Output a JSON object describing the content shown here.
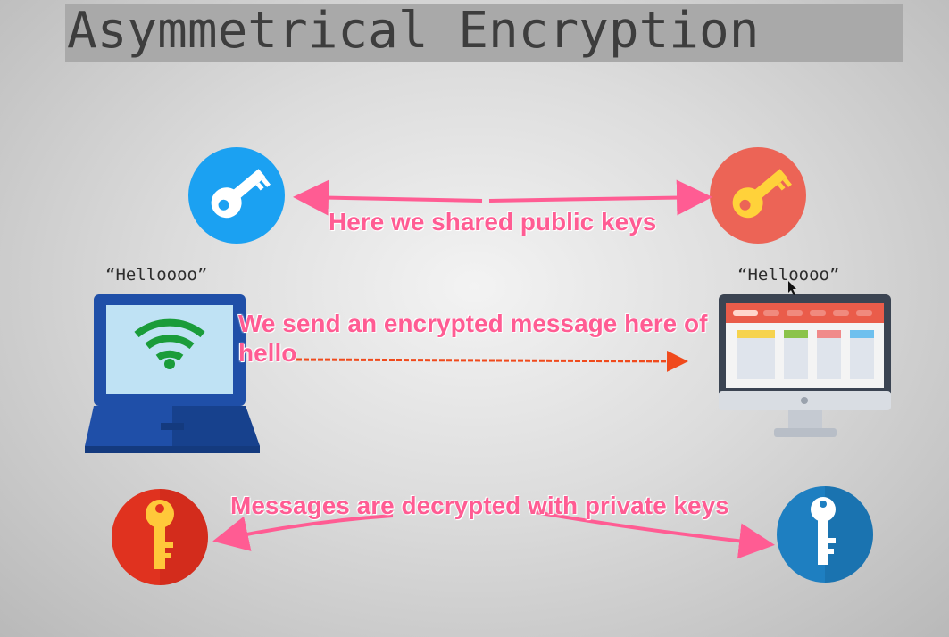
{
  "title": "Asymmetrical Encryption",
  "sender_message": "“Helloooo”",
  "receiver_message": "“Helloooo”",
  "annotations": {
    "public_keys": "Here we shared public keys",
    "encrypted_line1": "We send an encrypted message here of",
    "encrypted_line2": "hello",
    "private_keys": "Messages are decrypted with private keys"
  },
  "colors": {
    "annotation": "#ff5c93",
    "key_blue": "#1ba1f2",
    "key_red": "#ec6456",
    "key_red_dark": "#e0321f",
    "key_blue_dark": "#1e7fc1",
    "encrypted_arrow": "#f04a1c",
    "laptop": "#1f4fa8",
    "wifi": "#1a9c3a"
  }
}
